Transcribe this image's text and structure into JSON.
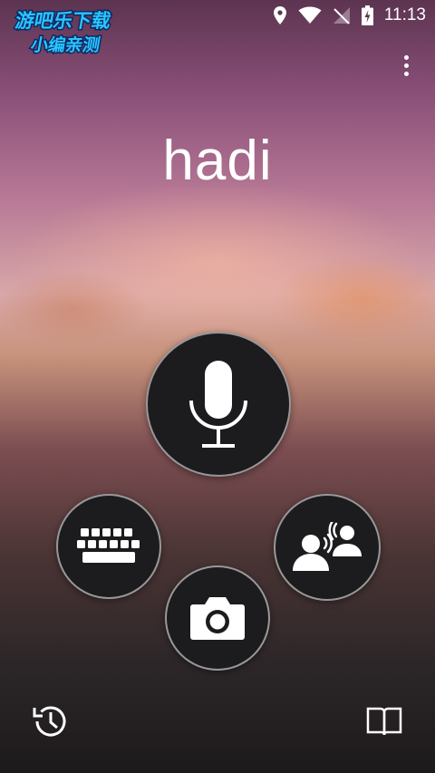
{
  "watermark": {
    "line1": "游吧乐下载",
    "line2": "小编亲测"
  },
  "status_bar": {
    "time": "11:13",
    "icons": [
      "location-icon",
      "wifi-icon",
      "no-signal-icon",
      "battery-charging-icon"
    ]
  },
  "main": {
    "recognized_text": "hadi"
  },
  "buttons": {
    "microphone": "microphone-icon",
    "keyboard": "keyboard-icon",
    "camera": "camera-icon",
    "conversation": "conversation-icon",
    "history": "history-icon",
    "phrasebook": "phrasebook-icon",
    "overflow_menu": "more-vert-icon"
  },
  "colors": {
    "button_bg": "#1c1b1d",
    "icon": "#ffffff",
    "watermark": "#29c6ff"
  }
}
